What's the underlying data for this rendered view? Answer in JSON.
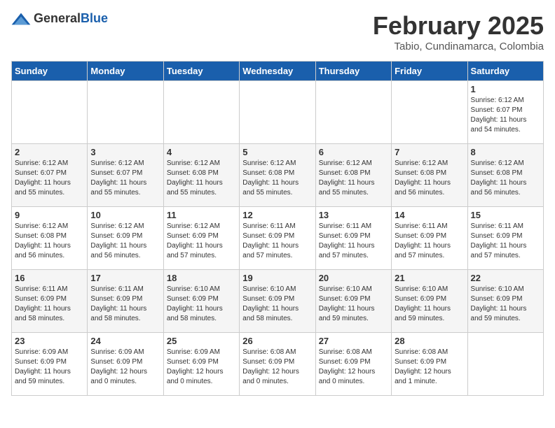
{
  "header": {
    "logo_general": "General",
    "logo_blue": "Blue",
    "title": "February 2025",
    "subtitle": "Tabio, Cundinamarca, Colombia"
  },
  "days_of_week": [
    "Sunday",
    "Monday",
    "Tuesday",
    "Wednesday",
    "Thursday",
    "Friday",
    "Saturday"
  ],
  "weeks": [
    [
      {
        "num": "",
        "info": ""
      },
      {
        "num": "",
        "info": ""
      },
      {
        "num": "",
        "info": ""
      },
      {
        "num": "",
        "info": ""
      },
      {
        "num": "",
        "info": ""
      },
      {
        "num": "",
        "info": ""
      },
      {
        "num": "1",
        "info": "Sunrise: 6:12 AM\nSunset: 6:07 PM\nDaylight: 11 hours\nand 54 minutes."
      }
    ],
    [
      {
        "num": "2",
        "info": "Sunrise: 6:12 AM\nSunset: 6:07 PM\nDaylight: 11 hours\nand 55 minutes."
      },
      {
        "num": "3",
        "info": "Sunrise: 6:12 AM\nSunset: 6:07 PM\nDaylight: 11 hours\nand 55 minutes."
      },
      {
        "num": "4",
        "info": "Sunrise: 6:12 AM\nSunset: 6:08 PM\nDaylight: 11 hours\nand 55 minutes."
      },
      {
        "num": "5",
        "info": "Sunrise: 6:12 AM\nSunset: 6:08 PM\nDaylight: 11 hours\nand 55 minutes."
      },
      {
        "num": "6",
        "info": "Sunrise: 6:12 AM\nSunset: 6:08 PM\nDaylight: 11 hours\nand 55 minutes."
      },
      {
        "num": "7",
        "info": "Sunrise: 6:12 AM\nSunset: 6:08 PM\nDaylight: 11 hours\nand 56 minutes."
      },
      {
        "num": "8",
        "info": "Sunrise: 6:12 AM\nSunset: 6:08 PM\nDaylight: 11 hours\nand 56 minutes."
      }
    ],
    [
      {
        "num": "9",
        "info": "Sunrise: 6:12 AM\nSunset: 6:08 PM\nDaylight: 11 hours\nand 56 minutes."
      },
      {
        "num": "10",
        "info": "Sunrise: 6:12 AM\nSunset: 6:09 PM\nDaylight: 11 hours\nand 56 minutes."
      },
      {
        "num": "11",
        "info": "Sunrise: 6:12 AM\nSunset: 6:09 PM\nDaylight: 11 hours\nand 57 minutes."
      },
      {
        "num": "12",
        "info": "Sunrise: 6:11 AM\nSunset: 6:09 PM\nDaylight: 11 hours\nand 57 minutes."
      },
      {
        "num": "13",
        "info": "Sunrise: 6:11 AM\nSunset: 6:09 PM\nDaylight: 11 hours\nand 57 minutes."
      },
      {
        "num": "14",
        "info": "Sunrise: 6:11 AM\nSunset: 6:09 PM\nDaylight: 11 hours\nand 57 minutes."
      },
      {
        "num": "15",
        "info": "Sunrise: 6:11 AM\nSunset: 6:09 PM\nDaylight: 11 hours\nand 57 minutes."
      }
    ],
    [
      {
        "num": "16",
        "info": "Sunrise: 6:11 AM\nSunset: 6:09 PM\nDaylight: 11 hours\nand 58 minutes."
      },
      {
        "num": "17",
        "info": "Sunrise: 6:11 AM\nSunset: 6:09 PM\nDaylight: 11 hours\nand 58 minutes."
      },
      {
        "num": "18",
        "info": "Sunrise: 6:10 AM\nSunset: 6:09 PM\nDaylight: 11 hours\nand 58 minutes."
      },
      {
        "num": "19",
        "info": "Sunrise: 6:10 AM\nSunset: 6:09 PM\nDaylight: 11 hours\nand 58 minutes."
      },
      {
        "num": "20",
        "info": "Sunrise: 6:10 AM\nSunset: 6:09 PM\nDaylight: 11 hours\nand 59 minutes."
      },
      {
        "num": "21",
        "info": "Sunrise: 6:10 AM\nSunset: 6:09 PM\nDaylight: 11 hours\nand 59 minutes."
      },
      {
        "num": "22",
        "info": "Sunrise: 6:10 AM\nSunset: 6:09 PM\nDaylight: 11 hours\nand 59 minutes."
      }
    ],
    [
      {
        "num": "23",
        "info": "Sunrise: 6:09 AM\nSunset: 6:09 PM\nDaylight: 11 hours\nand 59 minutes."
      },
      {
        "num": "24",
        "info": "Sunrise: 6:09 AM\nSunset: 6:09 PM\nDaylight: 12 hours\nand 0 minutes."
      },
      {
        "num": "25",
        "info": "Sunrise: 6:09 AM\nSunset: 6:09 PM\nDaylight: 12 hours\nand 0 minutes."
      },
      {
        "num": "26",
        "info": "Sunrise: 6:08 AM\nSunset: 6:09 PM\nDaylight: 12 hours\nand 0 minutes."
      },
      {
        "num": "27",
        "info": "Sunrise: 6:08 AM\nSunset: 6:09 PM\nDaylight: 12 hours\nand 0 minutes."
      },
      {
        "num": "28",
        "info": "Sunrise: 6:08 AM\nSunset: 6:09 PM\nDaylight: 12 hours\nand 1 minute."
      },
      {
        "num": "",
        "info": ""
      }
    ]
  ]
}
